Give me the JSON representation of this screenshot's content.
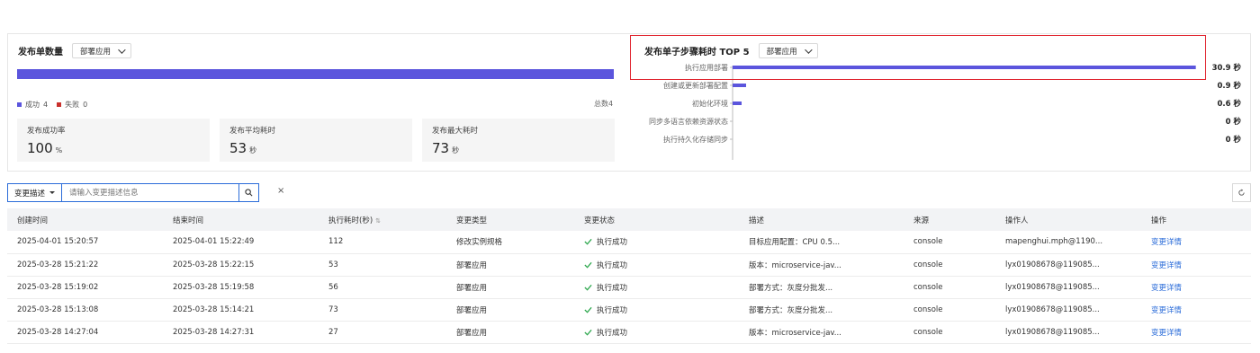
{
  "left_card": {
    "title": "发布单数量",
    "dropdown": "部署应用",
    "legend": [
      {
        "label": "成功",
        "count": "4",
        "color": "#5b55dd"
      },
      {
        "label": "失败",
        "count": "0",
        "color": "#c9302c"
      }
    ],
    "total_label": "总数4",
    "stats": [
      {
        "label": "发布成功率",
        "value": "100",
        "unit": "%"
      },
      {
        "label": "发布平均耗时",
        "value": "53",
        "unit": "秒"
      },
      {
        "label": "发布最大耗时",
        "value": "73",
        "unit": "秒"
      }
    ]
  },
  "right_card": {
    "title": "发布单子步骤耗时 TOP 5",
    "dropdown": "部署应用"
  },
  "chart_data": {
    "type": "bar",
    "orientation": "horizontal",
    "title": "发布单子步骤耗时 TOP 5",
    "categories": [
      "执行应用部署",
      "创建或更新部署配置",
      "初始化环境",
      "同步多语言依赖资源状态",
      "执行持久化存储同步"
    ],
    "values": [
      30.9,
      0.9,
      0.6,
      0,
      0
    ],
    "value_labels": [
      "30.9 秒",
      "0.9 秒",
      "0.6 秒",
      "0 秒",
      "0 秒"
    ],
    "x_ticks": [
      0,
      8,
      16,
      24,
      32
    ],
    "xlim": [
      0,
      32
    ],
    "bar_color": "#5b55dd"
  },
  "toolbar": {
    "filter_select": "变更描述",
    "search_placeholder": "请输入变更描述信息",
    "clear_glyph": "×"
  },
  "table": {
    "columns": [
      "创建时间",
      "结束时间",
      "执行耗时(秒)",
      "变更类型",
      "变更状态",
      "描述",
      "来源",
      "操作人",
      "操作"
    ],
    "sort_glyph": "⇅",
    "rows": [
      {
        "created": "2025-04-01 15:20:57",
        "ended": "2025-04-01 15:22:49",
        "duration": "112",
        "type": "修改实例规格",
        "status": "执行成功",
        "desc": "目标应用配置：CPU 0.5...",
        "source": "console",
        "operator": "mapenghui.mph@1190...",
        "action": "变更详情"
      },
      {
        "created": "2025-03-28 15:21:22",
        "ended": "2025-03-28 15:22:15",
        "duration": "53",
        "type": "部署应用",
        "status": "执行成功",
        "desc": "版本：microservice-jav...",
        "source": "console",
        "operator": "lyx01908678@119085...",
        "action": "变更详情"
      },
      {
        "created": "2025-03-28 15:19:02",
        "ended": "2025-03-28 15:19:58",
        "duration": "56",
        "type": "部署应用",
        "status": "执行成功",
        "desc": "部署方式：灰度分批发...",
        "source": "console",
        "operator": "lyx01908678@119085...",
        "action": "变更详情"
      },
      {
        "created": "2025-03-28 15:13:08",
        "ended": "2025-03-28 15:14:21",
        "duration": "73",
        "type": "部署应用",
        "status": "执行成功",
        "desc": "部署方式：灰度分批发...",
        "source": "console",
        "operator": "lyx01908678@119085...",
        "action": "变更详情"
      },
      {
        "created": "2025-03-28 14:27:04",
        "ended": "2025-03-28 14:27:31",
        "duration": "27",
        "type": "部署应用",
        "status": "执行成功",
        "desc": "版本：microservice-jav...",
        "source": "console",
        "operator": "lyx01908678@119085...",
        "action": "变更详情"
      }
    ]
  }
}
